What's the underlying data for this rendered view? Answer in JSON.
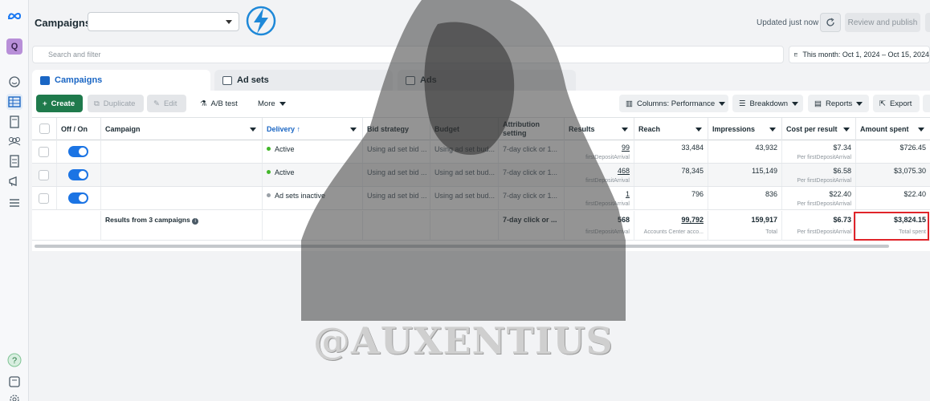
{
  "header": {
    "title": "Campaigns",
    "updated": "Updated just now",
    "review_publish": "Review and publish"
  },
  "search": {
    "placeholder": "Search and filter"
  },
  "date_range": "This month: Oct 1, 2024 – Oct 15, 2024",
  "avatar_letter": "Q",
  "tabs": [
    {
      "label": "Campaigns",
      "active": true
    },
    {
      "label": "Ad sets",
      "active": false
    },
    {
      "label": "Ads",
      "active": false
    }
  ],
  "toolbar": {
    "create": "Create",
    "duplicate": "Duplicate",
    "edit": "Edit",
    "ab_test": "A/B test",
    "more": "More",
    "columns": "Columns: Performance",
    "breakdown": "Breakdown",
    "reports": "Reports",
    "export": "Export"
  },
  "columns": [
    "Off / On",
    "Campaign",
    "Delivery ↑",
    "Bid strategy",
    "Budget",
    "Attribution setting",
    "Results",
    "Reach",
    "Impressions",
    "Cost per result",
    "Amount spent"
  ],
  "rows": [
    {
      "delivery": "Active",
      "delivery_color": "#42b72a",
      "bid": "Using ad set bid ...",
      "budget": "Using ad set bud...",
      "attribution": "7-day click or 1...",
      "results": "99",
      "results_sub": "firstDepositArrival",
      "reach": "33,484",
      "impressions": "43,932",
      "cpr": "$7.34",
      "cpr_sub": "Per firstDepositArrival",
      "spent": "$726.45"
    },
    {
      "delivery": "Active",
      "delivery_color": "#42b72a",
      "bid": "Using ad set bid ...",
      "budget": "Using ad set bud...",
      "attribution": "7-day click or 1...",
      "results": "468",
      "results_sub": "firstDepositArrival",
      "reach": "78,345",
      "impressions": "115,149",
      "cpr": "$6.58",
      "cpr_sub": "Per firstDepositArrival",
      "spent": "$3,075.30"
    },
    {
      "delivery": "Ad sets inactive",
      "delivery_color": "#9aa1a8",
      "bid": "Using ad set bid ...",
      "budget": "Using ad set bud...",
      "attribution": "7-day click or 1...",
      "results": "1",
      "results_sub": "firstDepositArrival",
      "reach": "796",
      "impressions": "836",
      "cpr": "$22.40",
      "cpr_sub": "Per firstDepositArrival",
      "spent": "$22.40"
    }
  ],
  "totals": {
    "label": "Results from 3 campaigns",
    "attribution": "7-day click or ...",
    "results": "568",
    "results_sub": "firstDepositArrival",
    "reach": "99,792",
    "reach_sub": "Accounts Center acco...",
    "impressions": "159,917",
    "impressions_sub": "Total",
    "cpr": "$6.73",
    "cpr_sub": "Per firstDepositArrival",
    "spent": "$3,824.15",
    "spent_sub": "Total spent"
  },
  "watermark": "@AUXENTIUS",
  "colors": {
    "create_green": "#1f7a4c",
    "accent_blue": "#1a66c4",
    "toggle_blue": "#1b74e4",
    "highlight_red": "#e0242a"
  }
}
